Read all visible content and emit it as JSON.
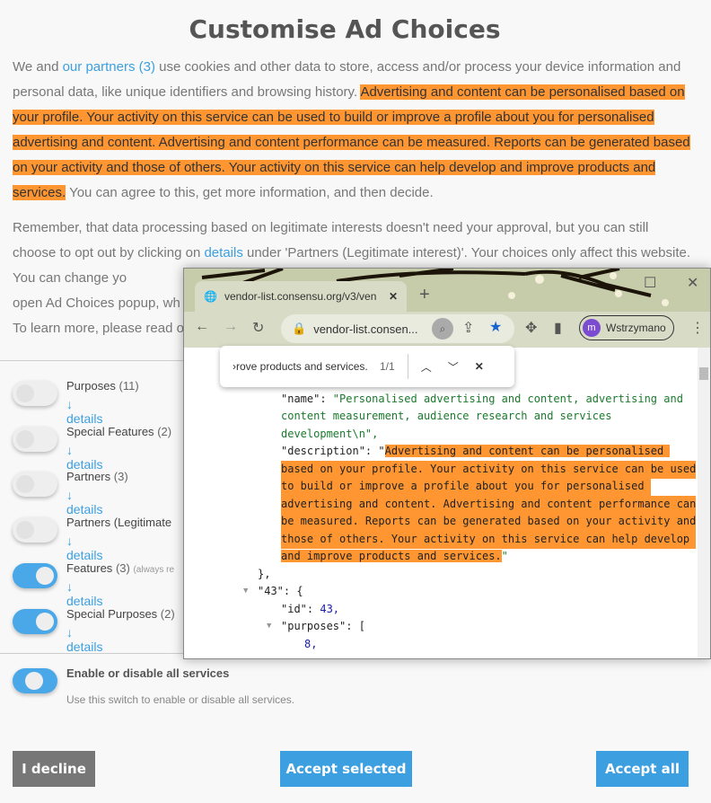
{
  "title": "Customise Ad Choices",
  "intro": {
    "p1_a": "We and ",
    "partners_link": "our partners (3)",
    "p1_b": " use cookies and other data to store, access and/or process your device information and personal data, like unique identifiers and browsing history. ",
    "p1_hl": "Advertising and content can be personalised based on your profile. Your activity on this service can be used to build or improve a profile about you for personalised advertising and content. Advertising and content performance can be measured. Reports can be generated based on your activity and those of others. Your activity on this service can help develop and improve products and services.",
    "p1_c": " You can agree to this, get more information, and then decide."
  },
  "remember": {
    "a": "Remember, that data processing based on legitimate interests doesn't need your approval, but you can still choose to opt out by clicking on ",
    "link": "details",
    "b": " under 'Partners (Legitimate interest)'. Your choices only affect this website. You can change yo",
    "c": "open Ad Choices popup, wh",
    "d": "To learn more, please read o"
  },
  "toggles": [
    {
      "label": "Purposes",
      "count": "(11)",
      "details": "↓ details",
      "on": false
    },
    {
      "label": "Special Features",
      "count": "(2)",
      "details": "↓ details",
      "on": false
    },
    {
      "label": "Partners",
      "count": "(3)",
      "details": "↓ details",
      "on": false
    },
    {
      "label": "Partners (Legitimate",
      "count": "",
      "details": "↓ details",
      "on": false
    },
    {
      "label": "Features",
      "count": "(3)",
      "note": "(always re",
      "details": "↓ details",
      "on": true
    },
    {
      "label": "Special Purposes",
      "count": "(2)",
      "details": "↓ details",
      "on": true
    }
  ],
  "all": {
    "label": "Enable or disable all services",
    "hint": "Use this switch to enable or disable all services.",
    "on": true
  },
  "buttons": {
    "decline": "I decline",
    "accept_selected": "Accept selected",
    "accept_all": "Accept all"
  },
  "colors": {
    "accent": "#3c9fe0",
    "highlight": "#ff9632",
    "decline": "#777777"
  },
  "browser": {
    "tab_title": "vendor-list.consensu.org/v3/ven",
    "url": "vendor-list.consen...",
    "profile_initial": "m",
    "profile_name": "Wstrzymano",
    "find_text": "›rove products and services.",
    "find_count": "1/1",
    "code": {
      "l1a": "\"name\": ",
      "l1b": "\"Personalised advertising and content, advertising and",
      "l2": "content measurement, audience research and services",
      "l3": "development\\n\",",
      "l4a": "\"description\": \"",
      "l4b": "Advertising and content can be personalised ",
      "l5": "based on your profile. Your activity on this service can be used",
      "l6": "to build or improve a profile about you for personalised ",
      "l7": "advertising and content. Advertising and content performance can",
      "l8": "be measured. Reports can be generated based on your activity and",
      "l9": "those of others. Your activity on this service can help develop ",
      "l10": "and improve products and services.",
      "l10b": "\"",
      "l11": "},",
      "l12a": "\"43\": {",
      "l13a": "\"id\": ",
      "l13b": "43,",
      "l14": "\"purposes\": [",
      "l15": "8,"
    }
  }
}
